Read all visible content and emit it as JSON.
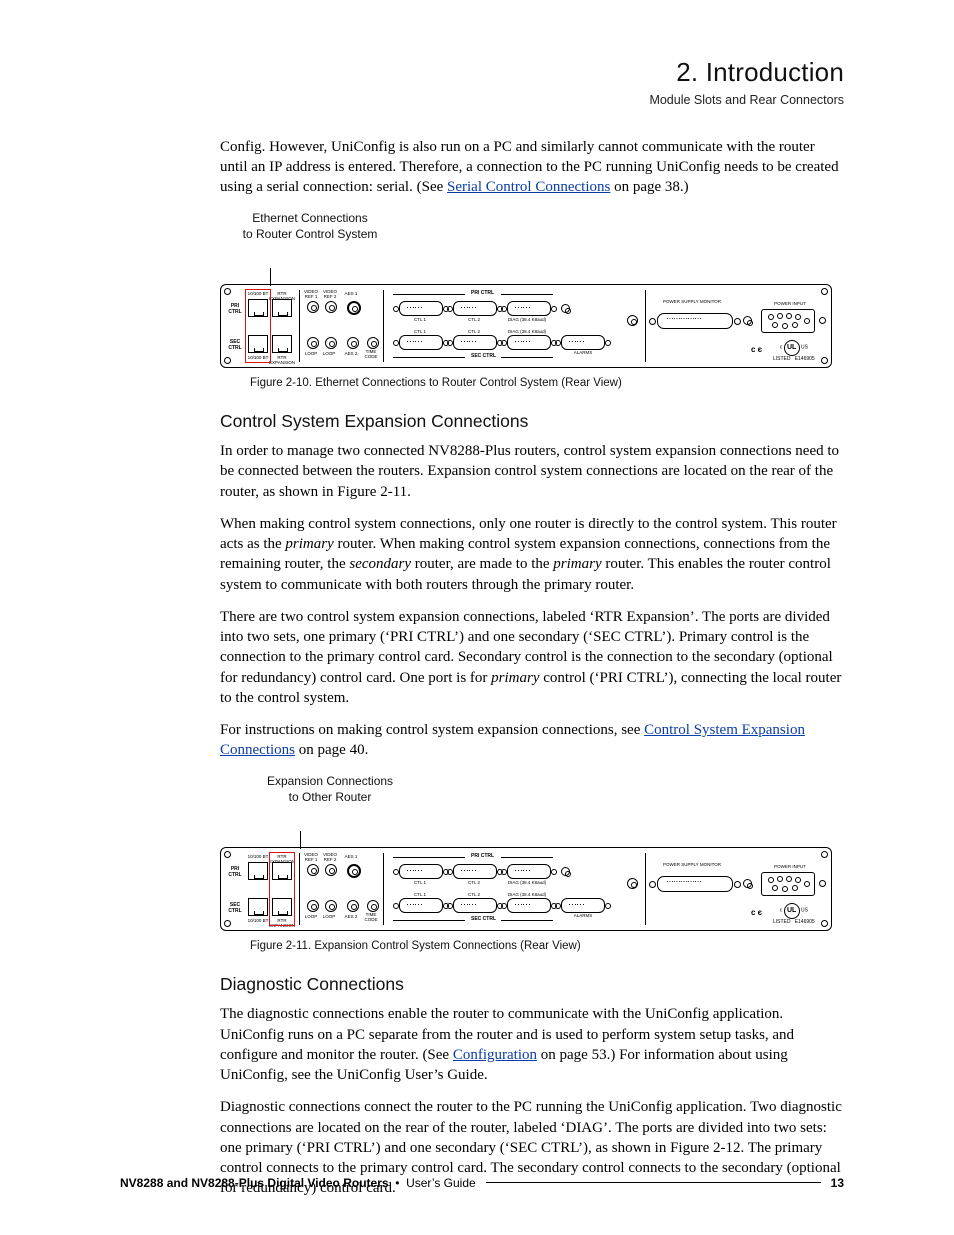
{
  "header": {
    "chapter": "2. Introduction",
    "section": "Module Slots and Rear Connectors"
  },
  "para1_a": "Config. However, UniConfig is also run on a PC and similarly cannot communicate with the router until an IP address is entered. Therefore, a connection to the PC running UniConfig needs to be created using a serial connection: serial. (See ",
  "para1_link": "Serial Control Connections",
  "para1_b": " on page 38.)",
  "fig10_label_l1": "Ethernet Connections",
  "fig10_label_l2": "to Router Control System",
  "fig10_caption": "Figure 2-10. Ethernet Connections to Router Control System (Rear View)",
  "h2a": "Control System Expansion Connections",
  "para2": "In order to manage two connected NV8288-Plus routers, control system expansion connections need to be connected between the routers. Expansion control system connections are located on the rear of the router, as shown in Figure 2-11.",
  "para3_a": "When making control system connections, only one router is directly to the control system. This router acts as the ",
  "para3_i1": "primary",
  "para3_b": " router. When making control system expansion connections, connections from the remaining router, the ",
  "para3_i2": "secondary",
  "para3_c": " router, are made to the ",
  "para3_i3": "primary",
  "para3_d": " router. This enables the router control system to communicate with both routers through the primary router.",
  "para4_a": "There are two control system expansion connections, labeled ‘RTR Expansion’. The ports are divided into two sets, one primary (‘PRI CTRL’) and one secondary (‘SEC CTRL’). Primary control is the connection to the primary control card. Secondary control is the connection to the secondary (optional for redundancy) control card. One port is for ",
  "para4_i1": "primary",
  "para4_b": " control (‘PRI CTRL’), connecting the local router to the control system.",
  "para5_a": "For instructions on making control system expansion connections, see ",
  "para5_link": "Control System Expansion Connections",
  "para5_b": " on page 40.",
  "fig11_label_l1": "Expansion Connections",
  "fig11_label_l2": "to Other Router",
  "fig11_caption": "Figure 2-11. Expansion Control System Connections (Rear View)",
  "h2b": "Diagnostic Connections",
  "para6_a": "The diagnostic connections enable the router to communicate with the UniConfig application. UniConfig runs on a PC separate from the router and is used to perform system setup tasks, and configure and monitor the router. (See ",
  "para6_link": "Configuration",
  "para6_b": " on page 53.) For information about using UniConfig, see the UniConfig User’s Guide.",
  "para7": "Diagnostic connections connect the router to the PC running the UniConfig application. Two diagnostic connections are located on the rear of the router, labeled ‘DIAG’. The ports are divided into two sets: one primary (‘PRI CTRL’) and one secondary (‘SEC CTRL’), as shown in Figure 2-12. The primary control connects to the primary control card. The secondary control connects to the secondary (optional for redundancy) control card.",
  "footer": {
    "doc": "NV8288 and NV8288-Plus Digital Video Routers",
    "sep": "•",
    "kind": "User’s Guide",
    "page": "13"
  },
  "panel_text": {
    "pri": "PRI CTRL",
    "sec": "SEC CTRL",
    "eth": "10/100 BT",
    "exp": "RTR EXPANSION",
    "vref1": "VIDEO REF 1",
    "vref2": "VIDEO REF 2",
    "aes1": "AES 1",
    "aes2": "AES 2",
    "loop": "LOOP",
    "tc": "TIME CODE",
    "ctl1": "CTL 1",
    "ctl2": "CTL 2",
    "diag": "DIAG (38.4 K8aud)",
    "alarms": "ALARMS",
    "psm": "POWER SUPPLY MONITOR",
    "pinput": "POWER INPUT",
    "ce": "c є",
    "listed": "LISTED",
    "eno": "E146905",
    "us": "US"
  }
}
